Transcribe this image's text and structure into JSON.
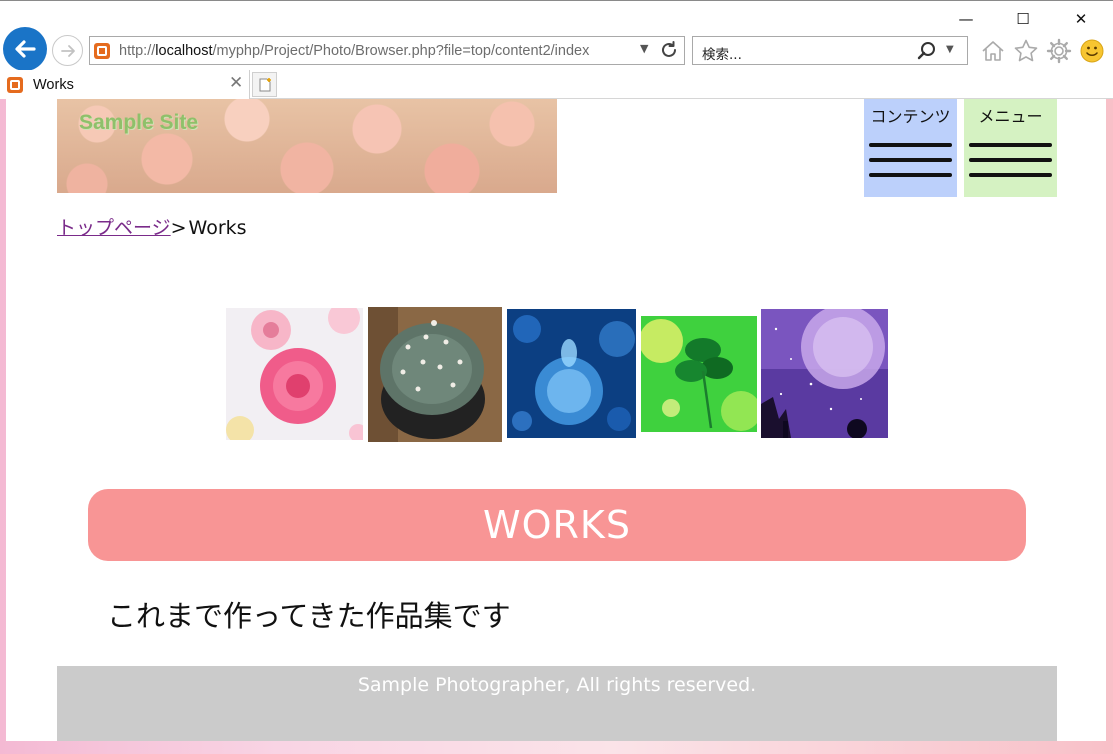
{
  "browser": {
    "address_url_prefix": "http://",
    "address_url_host": "localhost",
    "address_url_path": "/myphp/Project/Photo/Browser.php?file=top/content2/index",
    "search_placeholder": "検索...",
    "tab_title": "Works",
    "window_controls": {
      "minimize": "—",
      "maximize": "☐",
      "close": "✕"
    }
  },
  "header": {
    "site_title": "Sample Site",
    "menu_tiles": [
      {
        "label": "コンテンツ",
        "color": "#bcd0fb"
      },
      {
        "label": "メニュー",
        "color": "#d5f2c2"
      }
    ]
  },
  "breadcrumb": {
    "home_link": "トップページ",
    "separator": ">",
    "current": "Works"
  },
  "gallery": {
    "images": [
      {
        "name": "pink-flowers-photo"
      },
      {
        "name": "cactus-photo"
      },
      {
        "name": "blue-bubbles-photo"
      },
      {
        "name": "green-leaves-photo"
      },
      {
        "name": "purple-moon-photo"
      }
    ]
  },
  "section": {
    "title": "WORKS",
    "title_color": "#f89595",
    "lead": "これまで作ってきた作品集です"
  },
  "footer": {
    "copyright": "Sample Photographer, All rights reserved."
  }
}
